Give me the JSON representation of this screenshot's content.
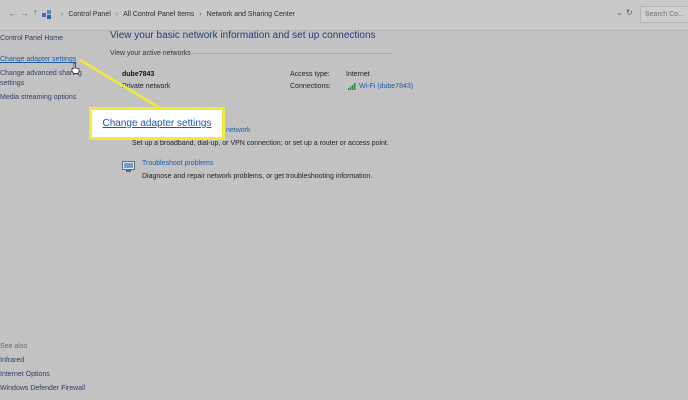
{
  "addressbar": {
    "crumbs": [
      "Control Panel",
      "All Control Panel Items",
      "Network and Sharing Center"
    ],
    "search_placeholder": "Search Co..."
  },
  "sidebar": {
    "home": "Control Panel Home",
    "change_adapter": "Change adapter settings",
    "change_advanced_line1": "Change advanced sharing",
    "change_advanced_line2": "settings",
    "media_streaming": "Media streaming options",
    "see_also": "See also",
    "infrared": "Infrared",
    "internet_options": "Internet Options",
    "firewall": "Windows Defender Firewall"
  },
  "main": {
    "title": "View your basic network information and set up connections",
    "active_networks_label": "View your active networks",
    "network_name": "dube7843",
    "network_type": "Private network",
    "access_type_label": "Access type:",
    "access_type_value": "Internet",
    "connections_label": "Connections:",
    "connections_value": "Wi-Fi (dube7843)",
    "tasks": {
      "setup_link_visible": "network",
      "setup_desc": "Set up a broadband, dial-up, or VPN connection; or set up a router or access point.",
      "troubleshoot_link": "Troubleshoot problems",
      "troubleshoot_desc": "Diagnose and repair network problems, or get troubleshooting information."
    }
  },
  "callout": {
    "text": "Change adapter settings",
    "color": "#f2e93c"
  }
}
